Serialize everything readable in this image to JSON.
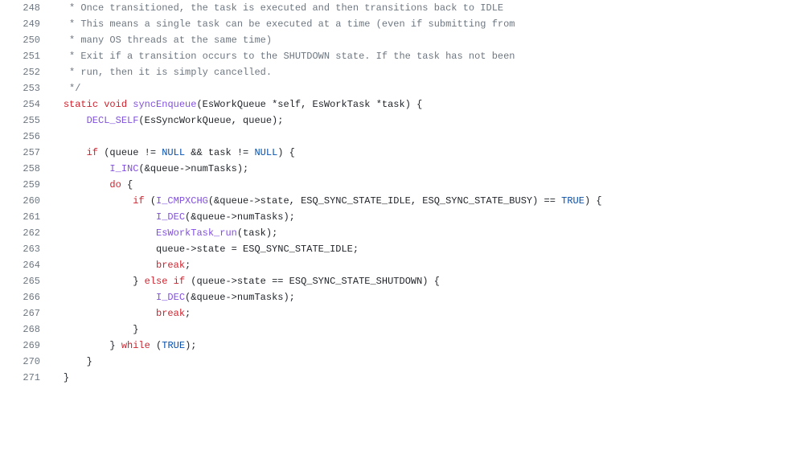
{
  "code": {
    "lines": [
      {
        "num": 248,
        "indent": "    ",
        "tokens": [
          {
            "cls": "tok-comment",
            "text": " * Once transitioned, the task is executed and then transitions back to IDLE"
          }
        ]
      },
      {
        "num": 249,
        "indent": "    ",
        "tokens": [
          {
            "cls": "tok-comment",
            "text": " * This means a single task can be executed at a time (even if submitting from"
          }
        ]
      },
      {
        "num": 250,
        "indent": "    ",
        "tokens": [
          {
            "cls": "tok-comment",
            "text": " * many OS threads at the same time)"
          }
        ]
      },
      {
        "num": 251,
        "indent": "    ",
        "tokens": [
          {
            "cls": "tok-comment",
            "text": " * Exit if a transition occurs to the SHUTDOWN state. If the task has not been"
          }
        ]
      },
      {
        "num": 252,
        "indent": "    ",
        "tokens": [
          {
            "cls": "tok-comment",
            "text": " * run, then it is simply cancelled."
          }
        ]
      },
      {
        "num": 253,
        "indent": "    ",
        "tokens": [
          {
            "cls": "tok-comment",
            "text": " */"
          }
        ]
      },
      {
        "num": 254,
        "indent": "    ",
        "tokens": [
          {
            "cls": "tok-keyword",
            "text": "static"
          },
          {
            "cls": "tok-text",
            "text": " "
          },
          {
            "cls": "tok-keyword",
            "text": "void"
          },
          {
            "cls": "tok-text",
            "text": " "
          },
          {
            "cls": "tok-func",
            "text": "syncEnqueue"
          },
          {
            "cls": "tok-text",
            "text": "(EsWorkQueue *self, EsWorkTask *task) {"
          }
        ]
      },
      {
        "num": 255,
        "indent": "        ",
        "tokens": [
          {
            "cls": "tok-func",
            "text": "DECL_SELF"
          },
          {
            "cls": "tok-text",
            "text": "(EsSyncWorkQueue, queue);"
          }
        ]
      },
      {
        "num": 256,
        "indent": "",
        "tokens": [
          {
            "cls": "tok-text",
            "text": ""
          }
        ]
      },
      {
        "num": 257,
        "indent": "        ",
        "tokens": [
          {
            "cls": "tok-keyword",
            "text": "if"
          },
          {
            "cls": "tok-text",
            "text": " (queue != "
          },
          {
            "cls": "tok-const",
            "text": "NULL"
          },
          {
            "cls": "tok-text",
            "text": " && task != "
          },
          {
            "cls": "tok-const",
            "text": "NULL"
          },
          {
            "cls": "tok-text",
            "text": ") {"
          }
        ]
      },
      {
        "num": 258,
        "indent": "            ",
        "tokens": [
          {
            "cls": "tok-func",
            "text": "I_INC"
          },
          {
            "cls": "tok-text",
            "text": "(&queue->numTasks);"
          }
        ]
      },
      {
        "num": 259,
        "indent": "            ",
        "tokens": [
          {
            "cls": "tok-keyword",
            "text": "do"
          },
          {
            "cls": "tok-text",
            "text": " {"
          }
        ]
      },
      {
        "num": 260,
        "indent": "                ",
        "tokens": [
          {
            "cls": "tok-keyword",
            "text": "if"
          },
          {
            "cls": "tok-text",
            "text": " ("
          },
          {
            "cls": "tok-func",
            "text": "I_CMPXCHG"
          },
          {
            "cls": "tok-text",
            "text": "(&queue->state, ESQ_SYNC_STATE_IDLE, ESQ_SYNC_STATE_BUSY) == "
          },
          {
            "cls": "tok-const",
            "text": "TRUE"
          },
          {
            "cls": "tok-text",
            "text": ") {"
          }
        ]
      },
      {
        "num": 261,
        "indent": "                    ",
        "tokens": [
          {
            "cls": "tok-func",
            "text": "I_DEC"
          },
          {
            "cls": "tok-text",
            "text": "(&queue->numTasks);"
          }
        ]
      },
      {
        "num": 262,
        "indent": "                    ",
        "tokens": [
          {
            "cls": "tok-func",
            "text": "EsWorkTask_run"
          },
          {
            "cls": "tok-text",
            "text": "(task);"
          }
        ]
      },
      {
        "num": 263,
        "indent": "                    ",
        "tokens": [
          {
            "cls": "tok-text",
            "text": "queue->state = ESQ_SYNC_STATE_IDLE;"
          }
        ]
      },
      {
        "num": 264,
        "indent": "                    ",
        "tokens": [
          {
            "cls": "tok-keyword",
            "text": "break"
          },
          {
            "cls": "tok-text",
            "text": ";"
          }
        ]
      },
      {
        "num": 265,
        "indent": "                ",
        "tokens": [
          {
            "cls": "tok-text",
            "text": "} "
          },
          {
            "cls": "tok-keyword",
            "text": "else"
          },
          {
            "cls": "tok-text",
            "text": " "
          },
          {
            "cls": "tok-keyword",
            "text": "if"
          },
          {
            "cls": "tok-text",
            "text": " (queue->state == ESQ_SYNC_STATE_SHUTDOWN) {"
          }
        ]
      },
      {
        "num": 266,
        "indent": "                    ",
        "tokens": [
          {
            "cls": "tok-func",
            "text": "I_DEC"
          },
          {
            "cls": "tok-text",
            "text": "(&queue->numTasks);"
          }
        ]
      },
      {
        "num": 267,
        "indent": "                    ",
        "tokens": [
          {
            "cls": "tok-keyword",
            "text": "break"
          },
          {
            "cls": "tok-text",
            "text": ";"
          }
        ]
      },
      {
        "num": 268,
        "indent": "                ",
        "tokens": [
          {
            "cls": "tok-text",
            "text": "}"
          }
        ]
      },
      {
        "num": 269,
        "indent": "            ",
        "tokens": [
          {
            "cls": "tok-text",
            "text": "} "
          },
          {
            "cls": "tok-keyword",
            "text": "while"
          },
          {
            "cls": "tok-text",
            "text": " ("
          },
          {
            "cls": "tok-const",
            "text": "TRUE"
          },
          {
            "cls": "tok-text",
            "text": ");"
          }
        ]
      },
      {
        "num": 270,
        "indent": "        ",
        "tokens": [
          {
            "cls": "tok-text",
            "text": "}"
          }
        ]
      },
      {
        "num": 271,
        "indent": "    ",
        "tokens": [
          {
            "cls": "tok-text",
            "text": "}"
          }
        ]
      }
    ]
  }
}
